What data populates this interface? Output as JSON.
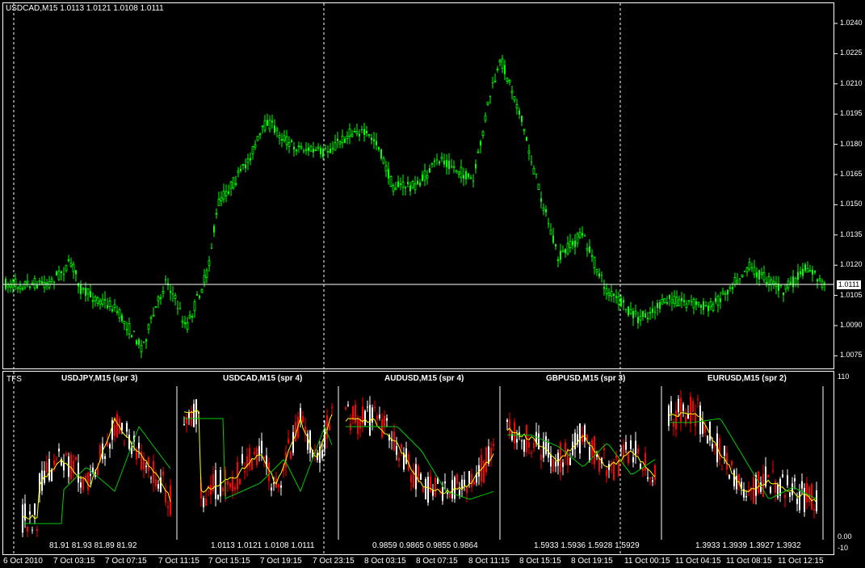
{
  "chart": {
    "symbol_header": "USDCAD,M15  1.0113 1.0121 1.0108 1.0111",
    "current_price": "1.0111",
    "price_labels": [
      "1.0240",
      "1.0225",
      "1.0210",
      "1.0195",
      "1.0180",
      "1.0165",
      "1.0150",
      "1.0135",
      "1.0120",
      "1.0105",
      "1.0090",
      "1.0075"
    ],
    "time_labels": [
      "6 Oct 2010",
      "7 Oct 03:15",
      "7 Oct 07:15",
      "7 Oct 11:15",
      "7 Oct 15:15",
      "7 Oct 19:15",
      "7 Oct 23:15",
      "8 Oct 03:15",
      "8 Oct 07:15",
      "8 Oct 11:15",
      "8 Oct 15:15",
      "8 Oct 19:15",
      "11 Oct 00:15",
      "11 Oct 04:15",
      "11 Oct 08:15",
      "11 Oct 12:15"
    ],
    "candle_color": "#00ff00",
    "line_color": "#ffffff"
  },
  "indicator": {
    "name": "TFS",
    "axis_labels": [
      "110",
      "0.00",
      "-10"
    ],
    "panels": [
      {
        "title": "USDJPY,M15 (spr 3)",
        "ohlc": "81.91  81.93  81.89  81.92"
      },
      {
        "title": "USDCAD,M15 (spr 4)",
        "ohlc": "1.0113  1.0121  1.0108  1.0111"
      },
      {
        "title": "AUDUSD,M15 (spr 4)",
        "ohlc": "0.9859  0.9865  0.9855  0.9864"
      },
      {
        "title": "GBPUSD,M15 (spr 3)",
        "ohlc": "1.5933  1.5936  1.5928  1.5929"
      },
      {
        "title": "EURUSD,M15 (spr 2)",
        "ohlc": "1.3933  1.3939  1.3927  1.3932"
      }
    ],
    "bull_color": "#ffffff",
    "bear_color": "#ff0000",
    "ma_fast_color": "#ffff00",
    "ma_slow_color": "#00cc00"
  }
}
